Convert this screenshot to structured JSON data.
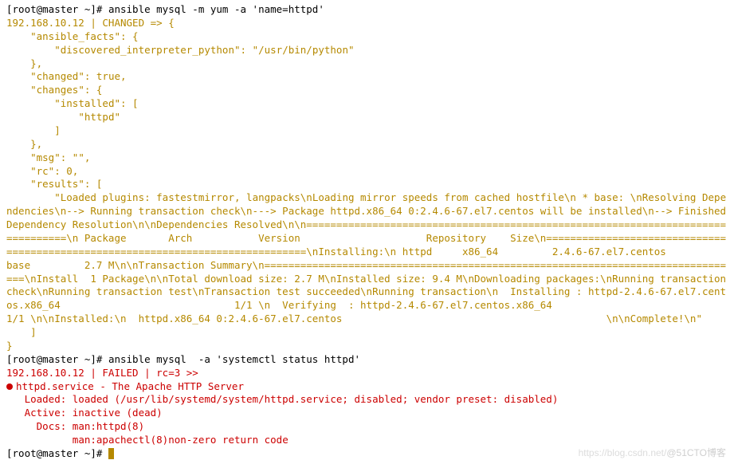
{
  "prompt1": "[root@master ~]# ",
  "cmd1": "ansible mysql -m yum -a 'name=httpd'",
  "out1_l1": "192.168.10.12 | CHANGED => {",
  "out1_l2": "    \"ansible_facts\": {",
  "out1_l3": "        \"discovered_interpreter_python\": \"/usr/bin/python\"",
  "out1_l4": "    },",
  "out1_l5": "    \"changed\": true,",
  "out1_l6": "    \"changes\": {",
  "out1_l7": "        \"installed\": [",
  "out1_l8": "            \"httpd\"",
  "out1_l9": "        ]",
  "out1_l10": "    },",
  "out1_l11": "    \"msg\": \"\",",
  "out1_l12": "    \"rc\": 0,",
  "out1_l13": "    \"results\": [",
  "out1_l14": "        \"Loaded plugins: fastestmirror, langpacks\\nLoading mirror speeds from cached hostfile\\n * base: \\nResolving Dependencies\\n--> Running transaction check\\n---> Package httpd.x86_64 0:2.4.6-67.el7.centos will be installed\\n--> Finished Dependency Resolution\\n\\nDependencies Resolved\\n\\n================================================================================\\n Package       Arch           Version                     Repository    Size\\n================================================================================\\nInstalling:\\n httpd     x86_64         2.4.6-67.el7.centos            base         2.7 M\\n\\nTransaction Summary\\n================================================================================\\nInstall  1 Package\\n\\nTotal download size: 2.7 M\\nInstalled size: 9.4 M\\nDownloading packages:\\nRunning transaction check\\nRunning transaction test\\nTransaction test succeeded\\nRunning transaction\\n  Installing : httpd-2.4.6-67.el7.centos.x86_64                             1/1 \\n  Verifying  : httpd-2.4.6-67.el7.centos.x86_64                             1/1 \\n\\nInstalled:\\n  httpd.x86_64 0:2.4.6-67.el7.centos                                            \\n\\nComplete!\\n\"",
  "out1_l15": "    ]",
  "out1_l16": "}",
  "prompt2": "[root@master ~]# ",
  "cmd2": "ansible mysql  -a 'systemctl status httpd'",
  "out2_l1": "192.168.10.12 | FAILED | rc=3 >>",
  "out2_l2": "httpd.service - The Apache HTTP Server",
  "out2_l3": "   Loaded: loaded (/usr/lib/systemd/system/httpd.service; disabled; vendor preset: disabled)",
  "out2_l4": "   Active: inactive (dead)",
  "out2_l5": "     Docs: man:httpd(8)",
  "out2_l6": "           man:apachectl(8)non-zero return code",
  "prompt3": "[root@master ~]# ",
  "watermark1": "https://blog.csdn.net/",
  "watermark2": "@51CTO博客"
}
